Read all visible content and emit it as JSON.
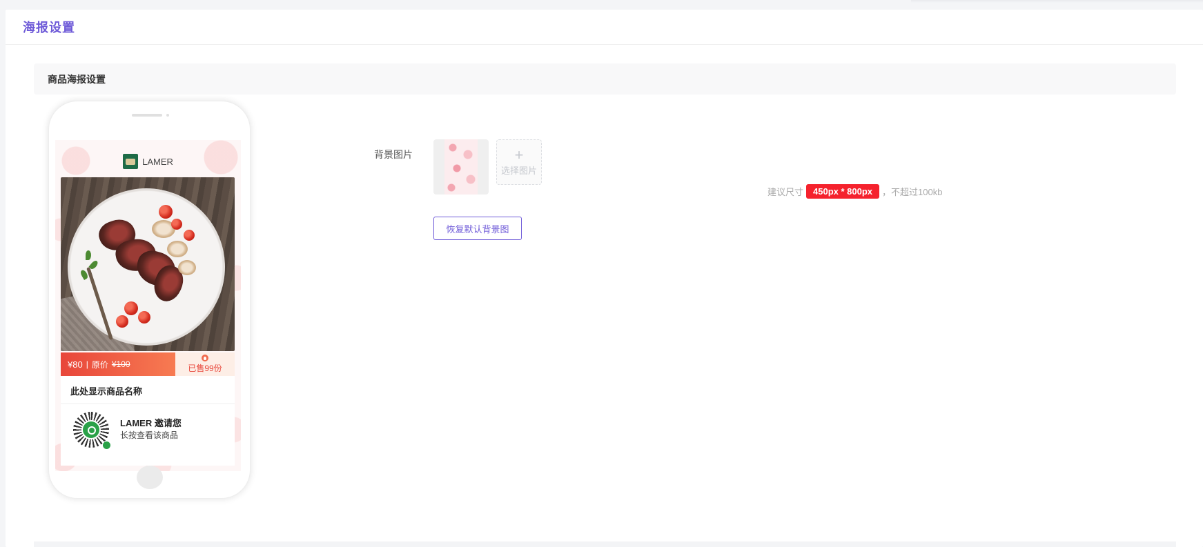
{
  "page": {
    "title": "海报设置",
    "section_title": "商品海报设置"
  },
  "poster_preview": {
    "shop_name": "LAMER",
    "price_now": "¥80",
    "price_separator": "|",
    "price_origin_label": "原价",
    "price_origin": "¥100",
    "sold_text": "已售99份",
    "product_name": "此处显示商品名称",
    "invite_title": "LAMER 邀请您",
    "invite_subtitle": "长按查看该商品"
  },
  "form": {
    "bg_label": "背景图片",
    "upload_plus": "+",
    "upload_label": "选择图片",
    "size_hint_prefix": "建议尺寸",
    "size_value": "450px * 800px",
    "size_hint_suffix": "，不超过100kb",
    "reset_button_label": "恢复默认背景图"
  },
  "colors": {
    "accent": "#6e5ad8",
    "badge_red": "#f5222d",
    "price_gradient_start": "#e8463a",
    "price_gradient_end": "#f77b52"
  }
}
